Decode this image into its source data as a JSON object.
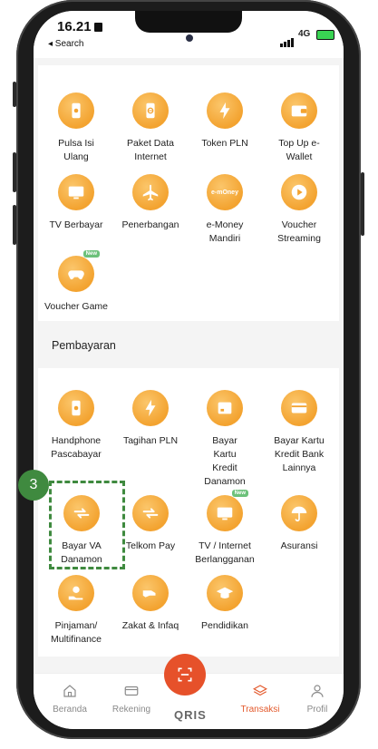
{
  "status_bar": {
    "time": "16.21",
    "back_label": "◂ Search",
    "network": "4G"
  },
  "purchase_section": {
    "items": [
      {
        "label": "Pulsa Isi Ulang",
        "icon": "phone-icon"
      },
      {
        "label": "Paket Data Internet",
        "icon": "globe-phone-icon"
      },
      {
        "label": "Token PLN",
        "icon": "lightning-icon"
      },
      {
        "label": "Top Up e-Wallet",
        "icon": "wallet-icon"
      },
      {
        "label": "TV Berbayar",
        "icon": "tv-icon"
      },
      {
        "label": "Penerbangan",
        "icon": "airplane-icon"
      },
      {
        "label": "e-Money Mandiri",
        "icon": "emoney-card-icon",
        "icon_text": "e-mOney"
      },
      {
        "label": "Voucher Streaming",
        "icon": "play-icon"
      },
      {
        "label": "Voucher Game",
        "icon": "gamepad-icon",
        "badge": "New"
      }
    ]
  },
  "payment_section": {
    "title": "Pembayaran",
    "items": [
      {
        "label": "Handphone Pascabayar",
        "icon": "phone-icon"
      },
      {
        "label": "Tagihan PLN",
        "icon": "lightning-icon"
      },
      {
        "label": "Bayar Kartu Kredit Danamon",
        "icon": "credit-card-icon"
      },
      {
        "label": "Bayar Kartu Kredit Bank Lainnya",
        "icon": "credit-card-icon"
      },
      {
        "label": "Bayar VA Danamon",
        "icon": "transfer-icon"
      },
      {
        "label": "Telkom Pay",
        "icon": "transfer-icon"
      },
      {
        "label": "TV / Internet Berlangganan",
        "icon": "tv-icon",
        "badge": "New"
      },
      {
        "label": "Asuransi",
        "icon": "umbrella-icon"
      },
      {
        "label": "Pinjaman/ Multifinance",
        "icon": "coin-hand-icon"
      },
      {
        "label": "Zakat & Infaq",
        "icon": "hand-heart-icon"
      },
      {
        "label": "Pendidikan",
        "icon": "graduation-cap-icon"
      }
    ]
  },
  "step_badge": "3",
  "tabbar": {
    "tabs": [
      {
        "label": "Beranda",
        "icon": "home-icon"
      },
      {
        "label": "Rekening",
        "icon": "card-icon"
      },
      {
        "label": "Transaksi",
        "icon": "layers-icon",
        "active": true
      },
      {
        "label": "Profil",
        "icon": "user-icon"
      }
    ],
    "center_logo": "QRIS",
    "center_icon": "qr-scan-icon"
  },
  "colors": {
    "accent": "#e6512a",
    "icon_orange": "#f3a330",
    "highlight_green": "#3f8a3f"
  }
}
